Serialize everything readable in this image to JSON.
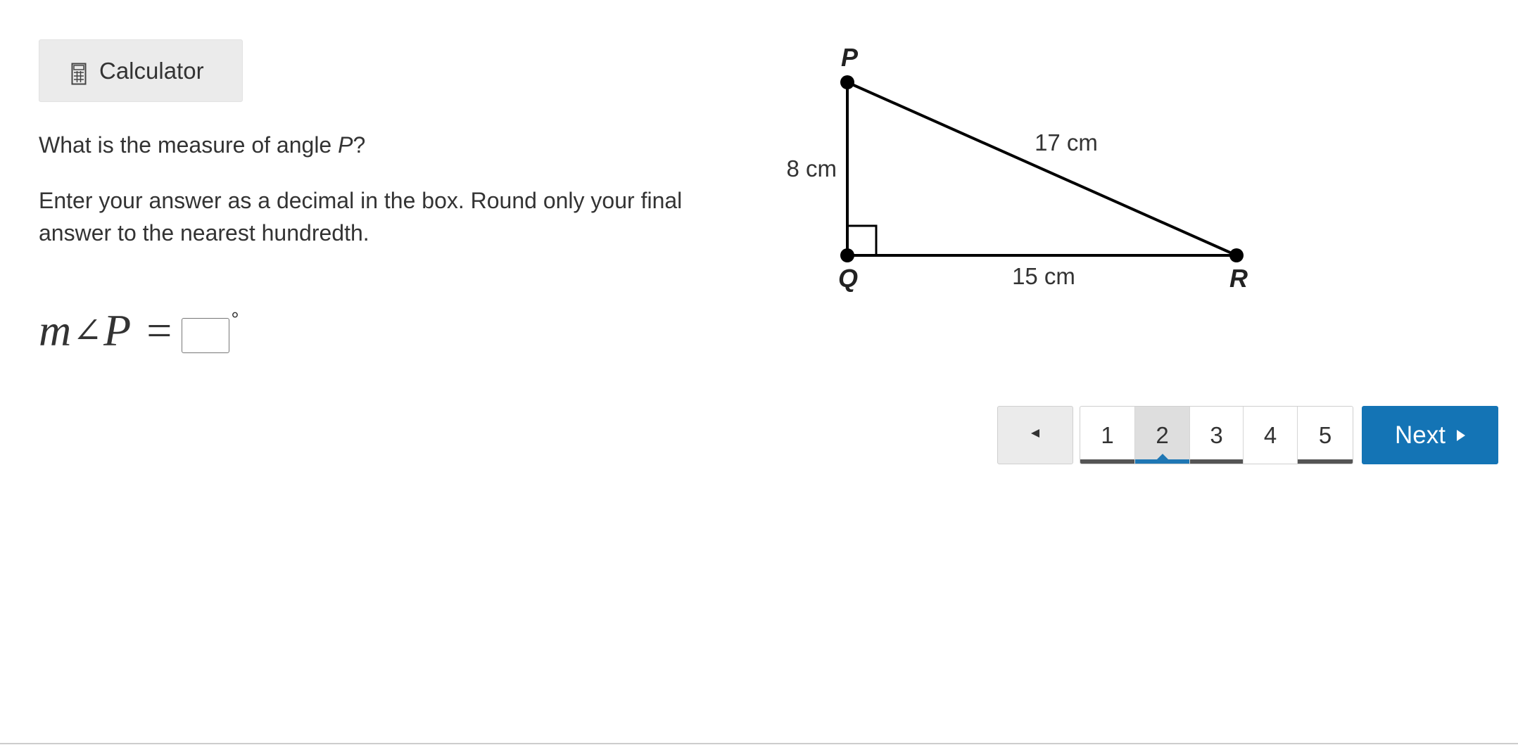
{
  "toolbar": {
    "calculator_label": "Calculator",
    "calculator_icon": "calculator-icon"
  },
  "question": {
    "prompt_before": "What is the measure of angle ",
    "prompt_var": "P",
    "prompt_after": "?",
    "instructions": "Enter your answer as a decimal in the box. Round only your final answer to the nearest hundredth."
  },
  "answer": {
    "m": "m",
    "angle_symbol": "∠",
    "var": "P",
    "equals": "=",
    "value": "",
    "unit": "°"
  },
  "figure": {
    "vertex_p": "P",
    "vertex_q": "Q",
    "vertex_r": "R",
    "side_pq": "8 cm",
    "side_pr": "17 cm",
    "side_qr": "15 cm"
  },
  "pagination": {
    "prev_icon": "triangle-left-icon",
    "pages": [
      "1",
      "2",
      "3",
      "4",
      "5"
    ],
    "current_page": "2",
    "next_label": "Next",
    "next_icon": "triangle-right-icon",
    "accent_color": "#1474b5"
  }
}
